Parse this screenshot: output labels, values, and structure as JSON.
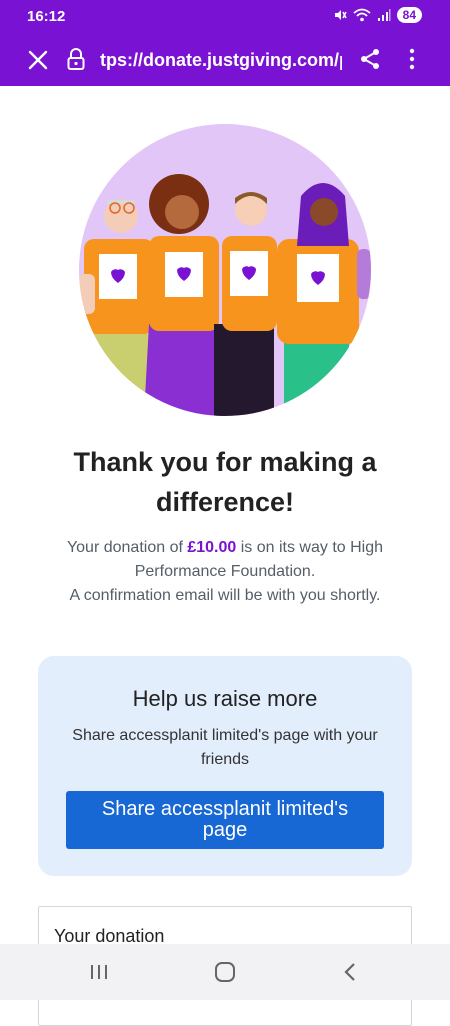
{
  "status_bar": {
    "time": "16:12",
    "battery": "84",
    "icons": [
      "mute-icon",
      "wifi-icon",
      "signal-icon",
      "battery-icon"
    ]
  },
  "browser": {
    "url": "tps://donate.justgiving.com/p",
    "icons": [
      "close-icon",
      "lock-icon",
      "share-icon",
      "more-vert-icon"
    ]
  },
  "theme": {
    "brand": "#7a12d4",
    "card_bg": "#e3eefc",
    "button": "#1767d4"
  },
  "thanks": {
    "title": "Thank you for making a difference!",
    "desc_prefix": "Your donation of ",
    "amount": "£10.00",
    "desc_suffix": " is on its way to High Performance Foundation.",
    "confirmation": "A confirmation email will be with you shortly."
  },
  "share_card": {
    "title": "Help us raise more",
    "subtitle": "Share accessplanit limited's page with your friends",
    "button_label": "Share accessplanit limited's page"
  },
  "donation_card": {
    "label": "Your donation"
  },
  "nav": {
    "icons": [
      "recents-icon",
      "home-icon",
      "back-icon"
    ]
  }
}
